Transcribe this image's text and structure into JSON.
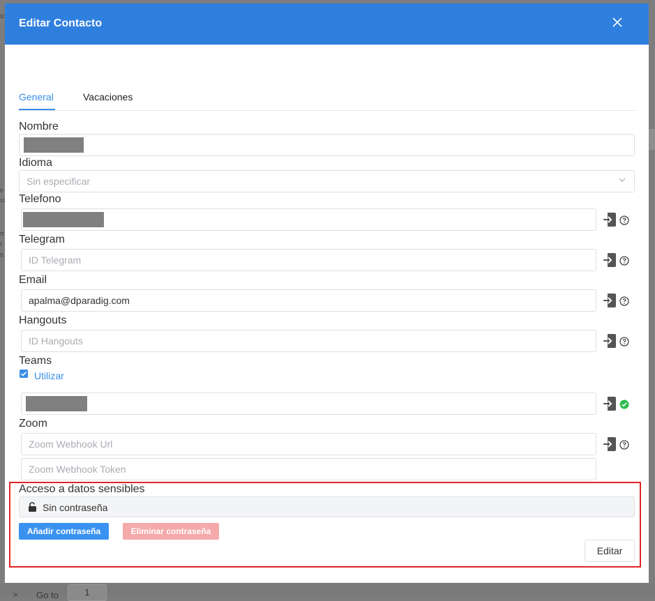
{
  "background": {
    "goto_label": "Go to",
    "goto_value": "1"
  },
  "modal": {
    "title": "Editar Contacto",
    "tabs": [
      {
        "label": "General",
        "active": true
      },
      {
        "label": "Vacaciones",
        "active": false
      }
    ],
    "fields": {
      "nombre": {
        "label": "Nombre",
        "value": ""
      },
      "idioma": {
        "label": "Idioma",
        "placeholder": "Sin especificar"
      },
      "telefono": {
        "label": "Telefono",
        "value": ""
      },
      "telegram": {
        "label": "Telegram",
        "placeholder": "ID Telegram"
      },
      "email": {
        "label": "Email",
        "value": "apalma@dparadig.com"
      },
      "hangouts": {
        "label": "Hangouts",
        "placeholder": "ID Hangouts"
      },
      "teams": {
        "label": "Teams",
        "checkbox_label": "Utilizar",
        "checked": true,
        "value": ""
      },
      "zoom": {
        "label": "Zoom",
        "url_placeholder": "Zoom Webhook Url",
        "token_placeholder": "Zoom Webhook Token"
      }
    },
    "sensitive": {
      "label": "Acceso a datos sensibles",
      "status": "Sin contraseña",
      "add_button": "Añadir contraseña",
      "delete_button": "Eliminar contraseña",
      "edit_button": "Editar"
    },
    "colors": {
      "header": "#2f7fdf",
      "accent": "#3a8ee6",
      "danger_disabled": "#f4a9aa",
      "success": "#2dbd4e",
      "highlight_border": "#e02424"
    },
    "icons": {
      "close": "close-icon",
      "import": "import-icon",
      "help": "help-icon",
      "check": "check-circle-icon",
      "lock": "unlock-icon",
      "chevron": "chevron-down-icon"
    }
  }
}
